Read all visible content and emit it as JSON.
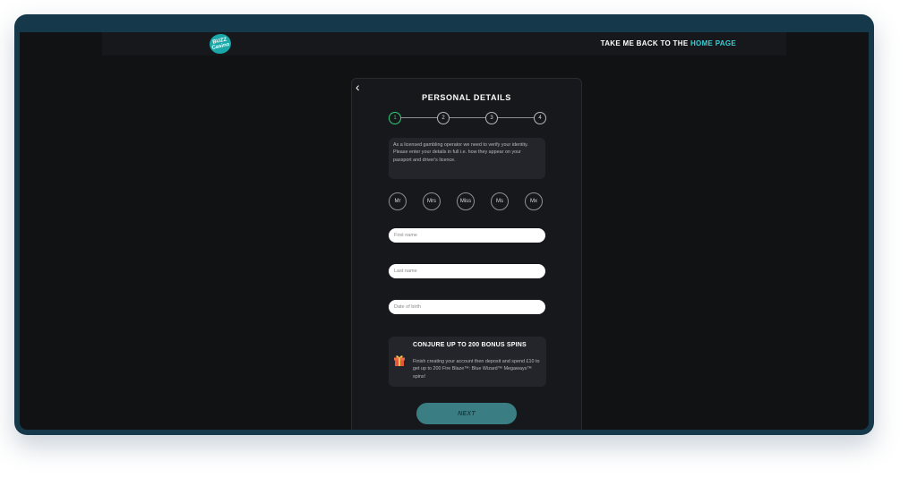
{
  "header": {
    "logo_text": "BUZZ Casino",
    "back_link_prefix": "TAKE ME BACK TO THE ",
    "back_link_highlight": "HOME PAGE"
  },
  "form": {
    "title": "PERSONAL DETAILS",
    "steps": [
      "1",
      "2",
      "3",
      "4"
    ],
    "active_step": 1,
    "info_text": "As a licensed gambling operator we need to verify your identity. Please enter your details in full i.e. how they appear on your passport and driver's licence.",
    "titles": [
      "Mr",
      "Mrs",
      "Miss",
      "Ms",
      "Mx"
    ],
    "first_name": {
      "placeholder": "First name",
      "value": ""
    },
    "last_name": {
      "placeholder": "Last name",
      "value": ""
    },
    "dob": {
      "placeholder": "Date of birth",
      "value": ""
    },
    "promo": {
      "title": "CONJURE UP TO 200 BONUS SPINS",
      "body": "Finish creating your account then deposit and spend £10 to get up to 200 Fire Blaze™: Blue Wizard™ Megaways™ spins!"
    },
    "next_label": "NEXT"
  },
  "colors": {
    "frame": "#15384a",
    "background": "#111214",
    "card": "#17181b",
    "accent": "#35d0d6",
    "active_step": "#2fcf7a",
    "next_button": "#3a7e83"
  },
  "icons": {
    "back": "chevron-left-icon",
    "promo": "gift-icon"
  }
}
